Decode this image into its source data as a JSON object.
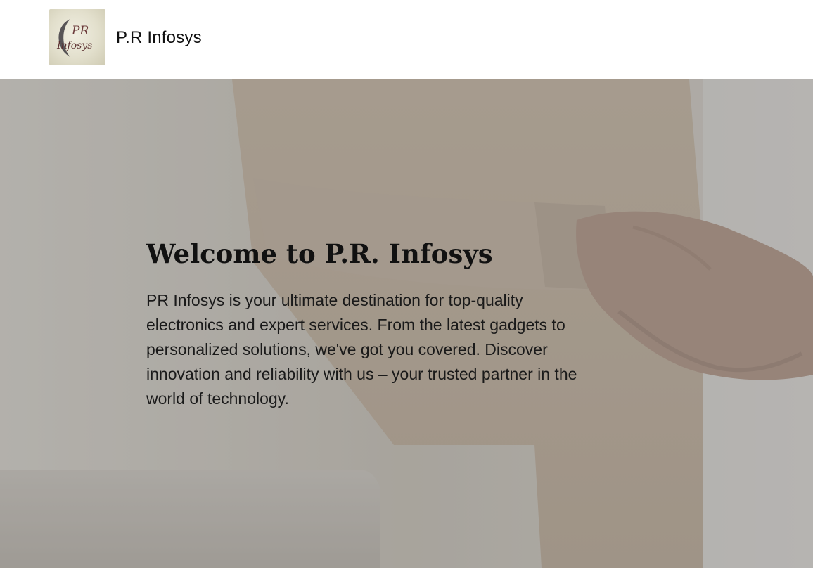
{
  "header": {
    "brand_name": "P.R Infosys",
    "logo": {
      "line1": "PR",
      "line2": "Infosys"
    }
  },
  "hero": {
    "title": "Welcome to P.R. Infosys",
    "description": "PR Infosys is your ultimate destination for top-quality electronics and expert services. From the latest gadgets to personalized solutions, we've got you covered. Discover innovation and reliability with us – your trusted partner in the world of technology.",
    "background_image": "handshake-photo"
  },
  "colors": {
    "header_bg": "#ffffff",
    "text": "#111111",
    "hero_overlay": "#a7a39c"
  }
}
